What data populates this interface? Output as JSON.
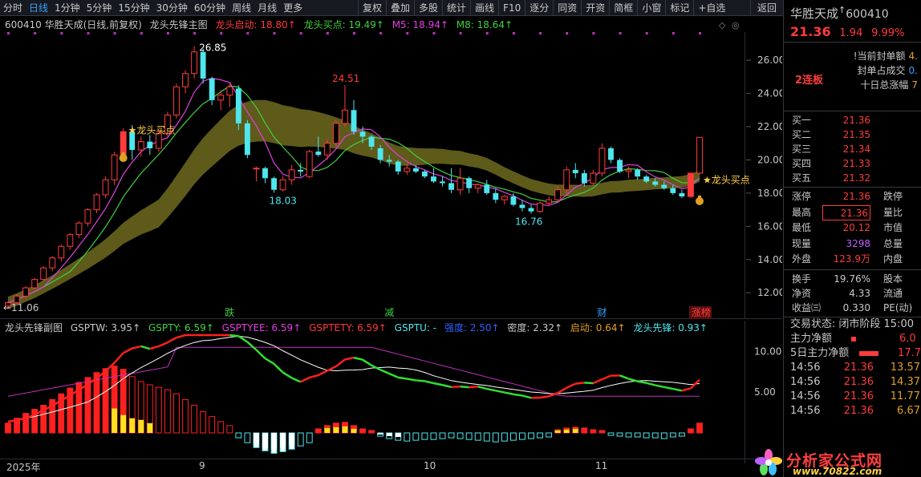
{
  "toolbar": {
    "periods": [
      "分时",
      "日线",
      "1分钟",
      "5分钟",
      "15分钟",
      "30分钟",
      "60分钟",
      "周线",
      "月线",
      "更多"
    ],
    "active_period": "日线",
    "funcs": [
      "复权",
      "叠加",
      "多股",
      "统计",
      "画线",
      "F10",
      "逐分",
      "同资",
      "开资",
      "简框",
      "小窗",
      "标记",
      "+自选"
    ],
    "back": "返回"
  },
  "main_legend": {
    "title": "600410 华胜天成(日线,前复权)",
    "indicator": "龙头先锋主图",
    "start": "龙头启动: 18.80↑",
    "buy": "龙头买点: 19.49↑",
    "m5": "M5: 18.94↑",
    "m8": "M8: 18.64↑"
  },
  "sub_legend": {
    "name": "龙头先锋副图",
    "gsptw": "GSPTW: 3.95↑",
    "gspty": "GSPTY: 6.59↑",
    "gsptyee": "GSPTYEE: 6.59↑",
    "gsptety": "GSPTETY: 6.59↑",
    "gsptu": "GSPTU: -",
    "qiangdu": "强度: 2.50↑",
    "midu": "密度: 2.32↑",
    "qidong": "启动: 0.64↑",
    "xianfeng": "龙头先锋: 0.93↑"
  },
  "price_axis": [
    "26.00",
    "24.00",
    "22.00",
    "20.00",
    "18.00",
    "16.00",
    "14.00",
    "12.00"
  ],
  "sub_axis": [
    "10.00",
    "5.00"
  ],
  "annotations": {
    "high_label": "26.85",
    "peak2_label": "24.51",
    "low1_label": "18.03",
    "low2_label": "16.76",
    "start_label": "11.06",
    "buy_label_left": "★龙头买点",
    "buy_label_right": "★龙头买点"
  },
  "events": [
    "跌",
    "减",
    "财",
    "涨榜"
  ],
  "xaxis": [
    "2025年",
    "9",
    "10",
    "11"
  ],
  "colors": {
    "up": "#ff3b3b",
    "down": "#4fe6ee",
    "ma5": "#e040e0",
    "ma8": "#40d040",
    "band": "#6e6a1e",
    "axis": "#33383f"
  },
  "chart_data": {
    "type": "candlestick",
    "ylim": [
      10.9,
      27.6
    ],
    "candles": [
      [
        11.2,
        11.5,
        11.0,
        11.4
      ],
      [
        11.4,
        11.9,
        11.3,
        11.8
      ],
      [
        11.8,
        12.4,
        11.7,
        12.3
      ],
      [
        12.3,
        12.9,
        12.2,
        12.8
      ],
      [
        12.8,
        13.6,
        12.7,
        13.5
      ],
      [
        13.5,
        14.2,
        13.3,
        14.1
      ],
      [
        14.1,
        14.9,
        13.9,
        14.8
      ],
      [
        14.8,
        15.6,
        14.6,
        15.5
      ],
      [
        15.5,
        16.3,
        15.3,
        16.2
      ],
      [
        16.2,
        17.1,
        16.0,
        17.0
      ],
      [
        17.0,
        18.0,
        16.8,
        17.9
      ],
      [
        17.9,
        19.0,
        17.7,
        18.8
      ],
      [
        18.8,
        20.5,
        18.5,
        20.3
      ],
      [
        20.3,
        21.9,
        20.0,
        21.7
      ],
      [
        21.7,
        22.1,
        20.0,
        20.6
      ],
      [
        20.6,
        21.4,
        20.2,
        21.1
      ],
      [
        21.1,
        21.5,
        20.3,
        20.7
      ],
      [
        20.7,
        21.8,
        20.5,
        21.6
      ],
      [
        21.6,
        22.9,
        21.4,
        22.7
      ],
      [
        22.7,
        24.6,
        22.5,
        24.4
      ],
      [
        24.4,
        25.4,
        24.0,
        25.2
      ],
      [
        25.2,
        26.85,
        24.9,
        26.5
      ],
      [
        26.5,
        26.7,
        24.6,
        24.9
      ],
      [
        24.9,
        25.0,
        23.3,
        23.6
      ],
      [
        23.6,
        24.2,
        23.0,
        23.9
      ],
      [
        23.9,
        24.6,
        23.2,
        24.4
      ],
      [
        24.3,
        24.5,
        21.8,
        22.2
      ],
      [
        22.2,
        22.4,
        20.1,
        20.3
      ],
      [
        19.5,
        19.6,
        18.7,
        19.5
      ],
      [
        19.5,
        19.6,
        18.6,
        18.9
      ],
      [
        18.9,
        19.0,
        18.03,
        18.2
      ],
      [
        18.2,
        19.0,
        18.1,
        18.8
      ],
      [
        18.8,
        19.7,
        18.5,
        19.4
      ],
      [
        19.4,
        19.8,
        19.0,
        19.3
      ],
      [
        19.0,
        20.6,
        18.9,
        20.5
      ],
      [
        20.5,
        21.4,
        20.2,
        20.3
      ],
      [
        20.3,
        21.2,
        20.0,
        21.0
      ],
      [
        21.0,
        22.4,
        20.8,
        22.2
      ],
      [
        22.2,
        24.51,
        22.0,
        23.0
      ],
      [
        23.0,
        23.6,
        21.5,
        21.7
      ],
      [
        21.7,
        22.0,
        21.0,
        21.4
      ],
      [
        21.4,
        21.5,
        20.6,
        20.8
      ],
      [
        20.7,
        20.9,
        19.8,
        20.0
      ],
      [
        20.0,
        20.3,
        19.6,
        19.9
      ],
      [
        19.9,
        20.0,
        19.1,
        19.3
      ],
      [
        19.3,
        19.8,
        19.1,
        19.5
      ],
      [
        19.5,
        19.7,
        19.2,
        19.3
      ],
      [
        19.3,
        19.4,
        18.9,
        19.0
      ],
      [
        19.0,
        19.5,
        18.6,
        18.7
      ],
      [
        18.7,
        19.0,
        18.4,
        18.6
      ],
      [
        18.6,
        19.5,
        18.0,
        18.2
      ],
      [
        18.2,
        19.5,
        17.9,
        18.9
      ],
      [
        18.9,
        19.0,
        18.0,
        18.3
      ],
      [
        18.3,
        18.6,
        18.0,
        18.5
      ],
      [
        18.5,
        18.8,
        17.9,
        18.0
      ],
      [
        18.0,
        18.3,
        17.4,
        17.6
      ],
      [
        17.6,
        17.9,
        17.3,
        17.8
      ],
      [
        17.8,
        18.0,
        17.2,
        17.3
      ],
      [
        17.3,
        17.6,
        16.9,
        17.1
      ],
      [
        17.1,
        17.3,
        16.76,
        16.9
      ],
      [
        16.9,
        17.5,
        16.8,
        17.4
      ],
      [
        17.4,
        17.8,
        17.2,
        17.6
      ],
      [
        17.6,
        18.4,
        17.5,
        18.2
      ],
      [
        18.2,
        19.6,
        18.0,
        19.4
      ],
      [
        19.4,
        19.8,
        18.9,
        19.2
      ],
      [
        19.2,
        19.4,
        18.4,
        18.6
      ],
      [
        18.6,
        19.4,
        18.5,
        19.2
      ],
      [
        19.2,
        21.0,
        19.0,
        20.7
      ],
      [
        20.7,
        20.8,
        19.8,
        20.0
      ],
      [
        20.0,
        20.1,
        19.2,
        19.3
      ],
      [
        19.3,
        19.6,
        18.9,
        19.4
      ],
      [
        19.4,
        19.5,
        18.8,
        19.0
      ],
      [
        19.0,
        19.1,
        18.6,
        18.7
      ],
      [
        18.7,
        18.9,
        18.4,
        18.5
      ],
      [
        18.5,
        18.7,
        18.2,
        18.3
      ],
      [
        18.3,
        18.5,
        17.9,
        18.0
      ],
      [
        18.0,
        18.2,
        17.7,
        17.8
      ],
      [
        17.8,
        19.2,
        17.7,
        19.2
      ],
      [
        19.2,
        21.36,
        19.1,
        21.36
      ]
    ],
    "sub_bars": [
      [
        1.2,
        0
      ],
      [
        1.8,
        0
      ],
      [
        2.4,
        0
      ],
      [
        2.9,
        0
      ],
      [
        3.4,
        0
      ],
      [
        4.1,
        0
      ],
      [
        4.8,
        0
      ],
      [
        5.5,
        0
      ],
      [
        6.2,
        0
      ],
      [
        6.8,
        0
      ],
      [
        7.4,
        0
      ],
      [
        7.9,
        0
      ],
      [
        8.2,
        3.0
      ],
      [
        7.8,
        2.2
      ],
      [
        6.9,
        1.8
      ],
      [
        6.3,
        1.6
      ],
      [
        5.9,
        1.2
      ],
      [
        5.6,
        0
      ],
      [
        5.3,
        0
      ],
      [
        4.8,
        0
      ],
      [
        4.1,
        0
      ],
      [
        3.4,
        0
      ],
      [
        2.6,
        0
      ],
      [
        2.0,
        0
      ],
      [
        1.4,
        0
      ],
      [
        0.9,
        0
      ],
      [
        -0.6,
        0
      ],
      [
        -1.2,
        0
      ],
      [
        -1.8,
        -1.4
      ],
      [
        -2.2,
        -1.8
      ],
      [
        -2.5,
        -2.0
      ],
      [
        -2.3,
        -1.8
      ],
      [
        -2.0,
        -1.5
      ],
      [
        -1.6,
        0
      ],
      [
        -1.2,
        0
      ],
      [
        0.5,
        0
      ],
      [
        0.9,
        0.6
      ],
      [
        1.2,
        0.7
      ],
      [
        1.3,
        0.8
      ],
      [
        0.9,
        0.5
      ],
      [
        0.5,
        0
      ],
      [
        0.3,
        0
      ],
      [
        -0.4,
        -0.2
      ],
      [
        -0.7,
        -0.4
      ],
      [
        -0.9,
        -0.5
      ],
      [
        -1.0,
        0
      ],
      [
        -0.9,
        0
      ],
      [
        -0.8,
        0
      ],
      [
        -0.8,
        0
      ],
      [
        -0.7,
        0
      ],
      [
        -0.6,
        0
      ],
      [
        -0.7,
        0
      ],
      [
        -0.8,
        0
      ],
      [
        -0.9,
        0
      ],
      [
        -1.0,
        0
      ],
      [
        -1.1,
        0
      ],
      [
        -1.0,
        0
      ],
      [
        -0.9,
        0
      ],
      [
        -0.8,
        0
      ],
      [
        -0.7,
        0
      ],
      [
        -0.6,
        0
      ],
      [
        -0.5,
        0
      ],
      [
        0.4,
        0.3
      ],
      [
        0.6,
        0.4
      ],
      [
        0.7,
        0.5
      ],
      [
        0.6,
        0
      ],
      [
        0.4,
        0
      ],
      [
        0.3,
        0
      ],
      [
        -0.3,
        0
      ],
      [
        -0.4,
        0
      ],
      [
        -0.5,
        0
      ],
      [
        -0.5,
        0
      ],
      [
        -0.6,
        0
      ],
      [
        -0.6,
        0
      ],
      [
        -0.7,
        0
      ],
      [
        -0.5,
        0
      ],
      [
        -0.4,
        0
      ],
      [
        0.5,
        0
      ],
      [
        1.2,
        0
      ]
    ]
  },
  "right": {
    "name": "华胜天成",
    "arrow": "↑",
    "code": "600410",
    "price": "21.36",
    "change": "1.94",
    "pct": "9.99%",
    "badge": "2连板",
    "lu_lines": [
      {
        "label": "!当前封单额",
        "value": "4."
      },
      {
        "label": "封单占成交",
        "value": "0."
      },
      {
        "label": "十日总涨幅",
        "value": "7"
      }
    ],
    "bids": [
      {
        "label": "买一",
        "value": "21.36"
      },
      {
        "label": "买二",
        "value": "21.35"
      },
      {
        "label": "买三",
        "value": "21.34"
      },
      {
        "label": "买四",
        "value": "21.33"
      },
      {
        "label": "买五",
        "value": "21.32"
      }
    ],
    "quote": [
      {
        "l": "涨停",
        "v": "21.36",
        "l2": "跌停"
      },
      {
        "l": "最高",
        "v": "21.36",
        "l2": "量比"
      },
      {
        "l": "最低",
        "v": "20.12",
        "l2": "市值"
      },
      {
        "l": "现量",
        "v": "3298",
        "l2": "总量"
      },
      {
        "l": "外盘",
        "v": "123.9万",
        "l2": "内盘"
      }
    ],
    "stats": [
      {
        "l": "换手",
        "v": "19.76%",
        "l2": "股本"
      },
      {
        "l": "净资",
        "v": "4.33",
        "l2": "流通"
      },
      {
        "l": "收益㈢",
        "v": "0.330",
        "l2": "PE(动)"
      }
    ],
    "trade_state": "交易状态:",
    "trade_state_val": "闭市阶段 15:00",
    "main_flow": "主力净额",
    "main_flow_val": "6.0",
    "main_flow5": "5日主力净额",
    "main_flow5_val": "17.7",
    "ticks": [
      {
        "t": "14:56",
        "p": "21.36",
        "q": "13.57"
      },
      {
        "t": "14:56",
        "p": "21.36",
        "q": "14.37"
      },
      {
        "t": "14:56",
        "p": "21.36",
        "q": "11.77"
      },
      {
        "t": "14:56",
        "p": "21.36",
        "q": "6.67"
      }
    ]
  },
  "watermark": {
    "text": "分析家公式网",
    "url": "www.70822.com"
  }
}
